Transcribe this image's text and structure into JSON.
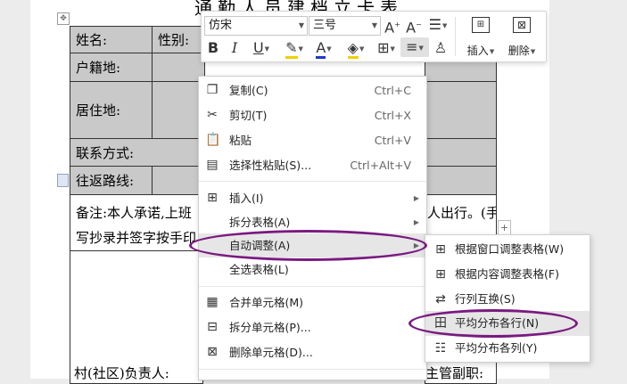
{
  "document": {
    "title": "通勤人员建档立卡表",
    "table": {
      "name_label": "姓名:",
      "gender_label": "性别:",
      "hukou_label": "户籍地:",
      "residence_label": "居住地:",
      "contact_label": "联系方式:",
      "route_label": "往返路线:",
      "note_line1": "备注:本人承诺,上班",
      "note_line1_tail": "人出行。(手",
      "note_line2": "写抄录并签字按手印",
      "bottom_left": "村(社区)负责人:",
      "bottom_right": "主管副职:"
    }
  },
  "toolbar": {
    "font_name": "仿宋",
    "font_size": "三号",
    "grow_font": "A",
    "shrink_font": "A",
    "bold": "B",
    "italic": "I",
    "underline": "U",
    "font_color_glyph": "A",
    "insert_label": "插入",
    "delete_label": "删除"
  },
  "context_menu": {
    "items": [
      {
        "icon": "copy-icon",
        "label": "复制(C)",
        "shortcut": "Ctrl+C"
      },
      {
        "icon": "cut-icon",
        "label": "剪切(T)",
        "shortcut": "Ctrl+X"
      },
      {
        "icon": "paste-icon",
        "label": "粘贴",
        "shortcut": "Ctrl+V"
      },
      {
        "icon": "paste-special-icon",
        "label": "选择性粘贴(S)...",
        "shortcut": "Ctrl+Alt+V"
      },
      {
        "icon": "table-insert-icon",
        "label": "插入(I)",
        "shortcut": ""
      },
      {
        "icon": "",
        "label": "拆分表格(A)",
        "shortcut": ""
      },
      {
        "icon": "",
        "label": "自动调整(A)",
        "shortcut": ""
      },
      {
        "icon": "",
        "label": "全选表格(L)",
        "shortcut": ""
      },
      {
        "icon": "merge-cells-icon",
        "label": "合并单元格(M)",
        "shortcut": ""
      },
      {
        "icon": "split-cells-icon",
        "label": "拆分单元格(P)...",
        "shortcut": ""
      },
      {
        "icon": "delete-cells-icon",
        "label": "删除单元格(D)...",
        "shortcut": ""
      }
    ]
  },
  "submenu": {
    "items": [
      {
        "icon": "fit-window-icon",
        "label": "根据窗口调整表格(W)"
      },
      {
        "icon": "fit-content-icon",
        "label": "根据内容调整表格(F)"
      },
      {
        "icon": "swap-rows-cols-icon",
        "label": "行列互换(S)"
      },
      {
        "icon": "distribute-rows-icon",
        "label": "平均分布各行(N)"
      },
      {
        "icon": "distribute-cols-icon",
        "label": "平均分布各列(Y)"
      }
    ]
  },
  "colors": {
    "highlight_oval": "#7a1a80",
    "selected_cell": "#c9c9c9",
    "font_color_bar": "#1a3cc8",
    "highlight_bar": "#f0d000"
  }
}
